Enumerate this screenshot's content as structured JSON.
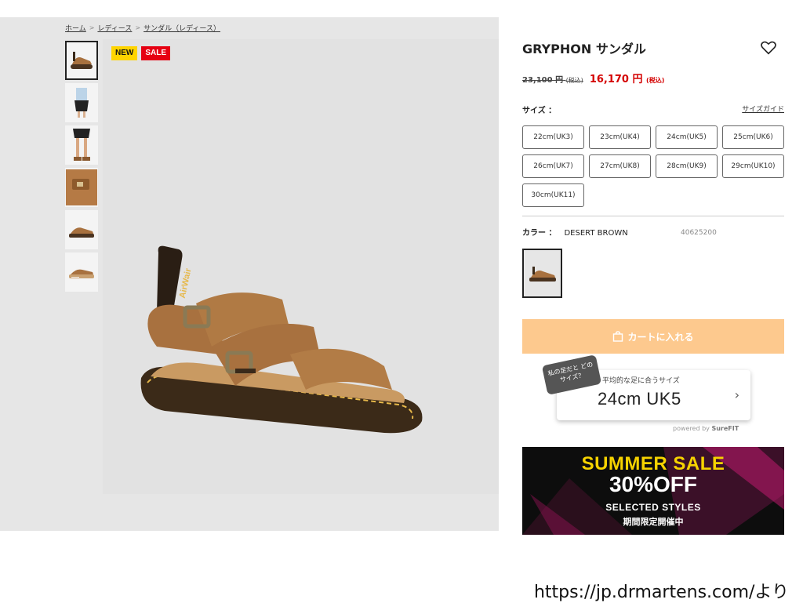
{
  "breadcrumb": [
    {
      "label": "ホーム"
    },
    {
      "label": "レディース"
    },
    {
      "label": "サンダル（レディース）"
    }
  ],
  "breadcrumb_separator": ">",
  "badges": {
    "new": "NEW",
    "sale": "SALE"
  },
  "product": {
    "title": "GRYPHON サンダル",
    "old_price": "23,100 円",
    "old_price_tax": "(税込)",
    "price": "16,170 円",
    "price_tax": "(税込)"
  },
  "size": {
    "label": "サイズ ：",
    "guide": "サイズガイド",
    "options": [
      "22cm(UK3)",
      "23cm(UK4)",
      "24cm(UK5)",
      "25cm(UK6)",
      "26cm(UK7)",
      "27cm(UK8)",
      "28cm(UK9)",
      "29cm(UK10)",
      "30cm(UK11)"
    ]
  },
  "color": {
    "label": "カラー ：",
    "value": "DESERT BROWN",
    "sku": "40625200"
  },
  "cart": {
    "label": "カートに入れる"
  },
  "surefit": {
    "bubble": "私の足だと どのサイズ？",
    "title": "平均的な足に合うサイズ",
    "value": "24cm UK5",
    "powered": "powered by",
    "brand": "SureFIT"
  },
  "banner": {
    "line1": "SUMMER SALE",
    "line2": "30%OFF",
    "line3": "SELECTED STYLES",
    "line4": "期間限定開催中"
  },
  "source": "https://jp.drmartens.com/より",
  "colors": {
    "sale_red": "#d40000",
    "cart_bg": "#fdc98e",
    "banner_yellow": "#f6d300"
  }
}
